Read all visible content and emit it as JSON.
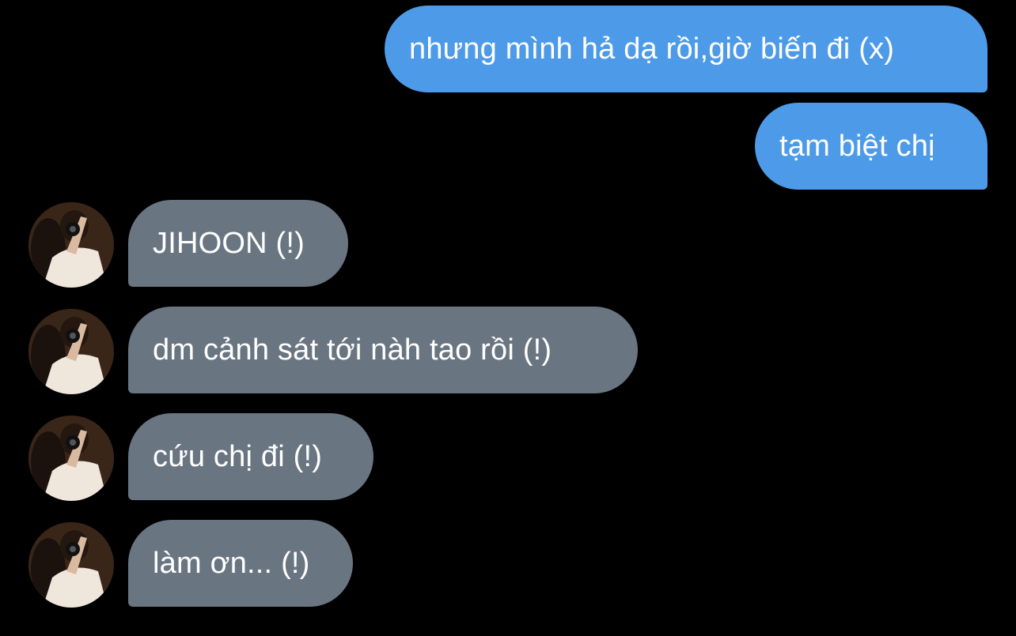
{
  "messages": [
    {
      "side": "out",
      "text": "nhưng mình hả dạ rồi,giờ biến đi (x)"
    },
    {
      "side": "out",
      "text": "tạm biệt chị"
    },
    {
      "side": "in",
      "text": "JIHOON (!)",
      "avatar": "contact-photo-avatar"
    },
    {
      "side": "in",
      "text": "dm cảnh sát tới nàh tao rồi (!)",
      "avatar": "contact-photo-avatar"
    },
    {
      "side": "in",
      "text": "cứu chị đi (!)",
      "avatar": "contact-photo-avatar"
    },
    {
      "side": "in",
      "text": "làm ơn... (!)",
      "avatar": "contact-photo-avatar"
    }
  ],
  "colors": {
    "background": "#000000",
    "outgoing_bubble": "#4d9be8",
    "incoming_bubble": "#6a7582",
    "text": "#ffffff"
  }
}
